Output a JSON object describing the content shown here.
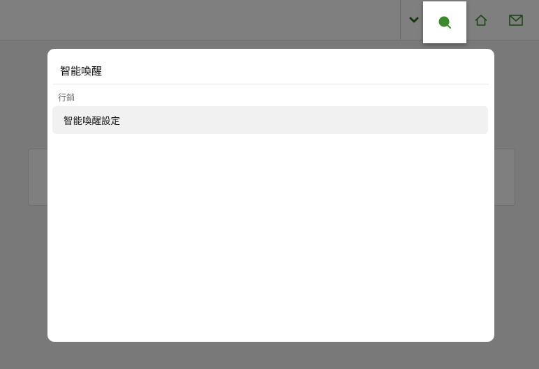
{
  "header": {
    "icons": {
      "dropdown": "chevron-down-icon",
      "search": "search-icon",
      "home": "home-icon",
      "mail": "mail-icon"
    }
  },
  "search_dialog": {
    "query": "智能喚醒",
    "groups": [
      {
        "label": "行銷",
        "results": [
          {
            "label": "智能喚醒設定"
          }
        ]
      }
    ]
  },
  "colors": {
    "accent": "#3d8a2a",
    "overlay": "rgba(0,0,0,0.5)"
  }
}
